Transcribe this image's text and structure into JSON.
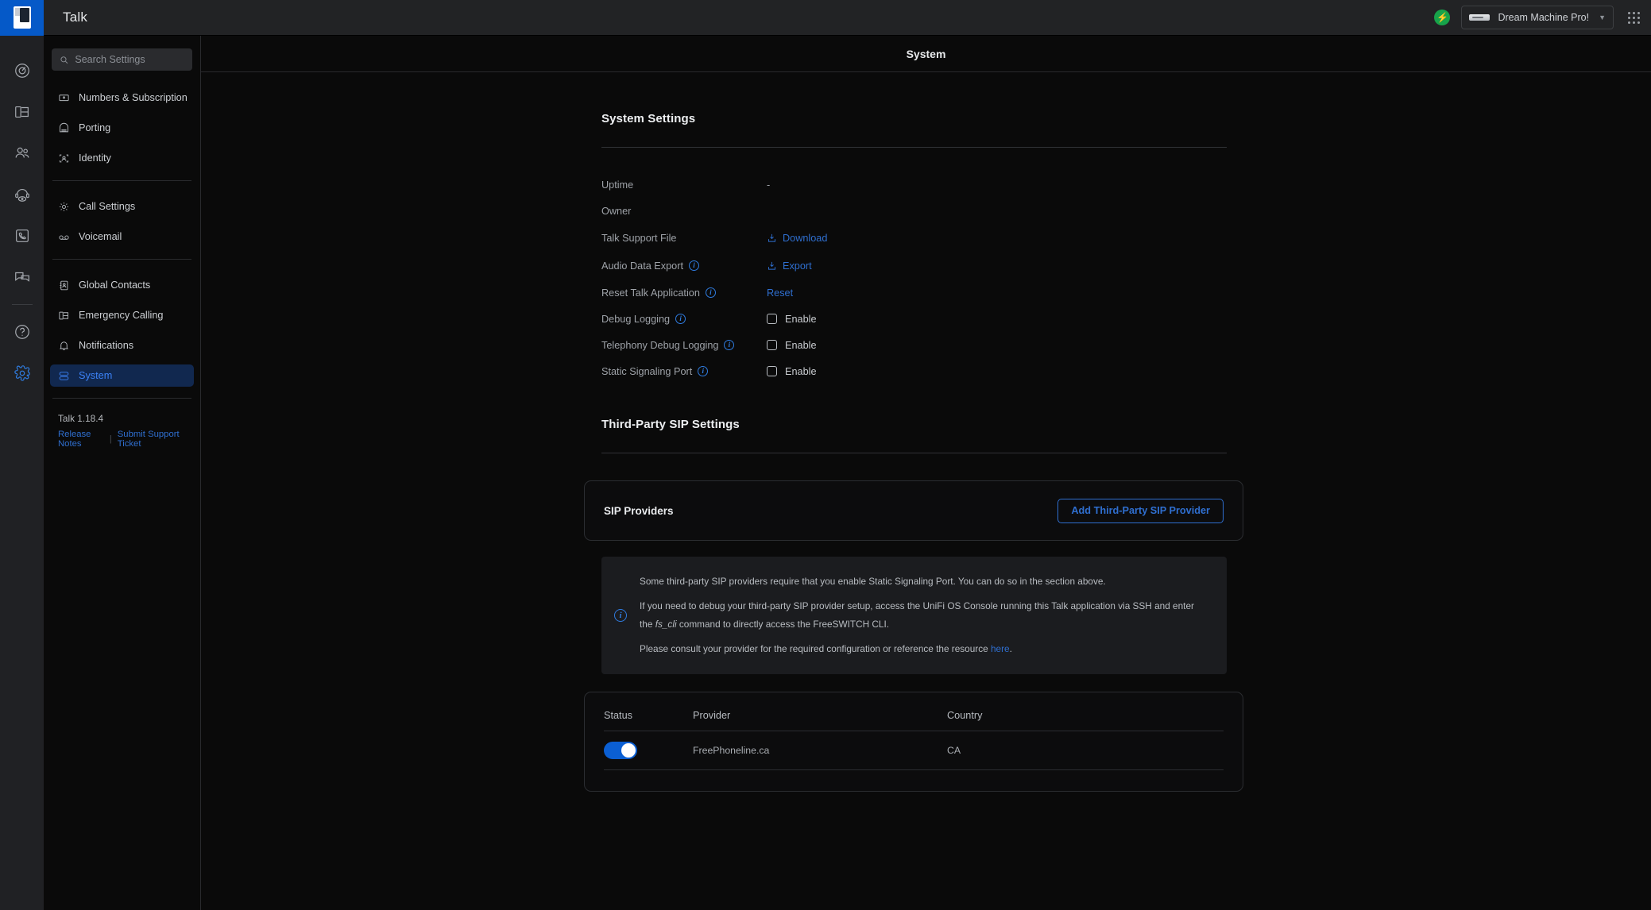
{
  "topbar": {
    "app_logo_icon": "talk-app-logo",
    "app_title": "Talk",
    "bolt_icon": "lightning-bolt-icon",
    "device_name": "Dream Machine Pro!",
    "device_icon": "device-icon",
    "chevron_icon": "chevron-down-icon",
    "launcher_icon": "app-grid-icon"
  },
  "rail": {
    "items": [
      {
        "icon": "dashboard-icon",
        "active": false
      },
      {
        "icon": "devices-icon",
        "active": false
      },
      {
        "icon": "users-icon",
        "active": false
      },
      {
        "icon": "agent-headset-icon",
        "active": false
      },
      {
        "icon": "contact-card-icon",
        "active": false
      },
      {
        "icon": "chat-bubbles-icon",
        "active": false
      },
      {
        "icon": "help-circle-icon",
        "active": false
      },
      {
        "icon": "settings-gear-icon",
        "active": true
      }
    ]
  },
  "sidebar": {
    "search": {
      "value": "",
      "placeholder": "Search Settings",
      "icon": "search-icon"
    },
    "groups": [
      {
        "items": [
          {
            "label": "Numbers & Subscription",
            "icon": "number-plate-icon",
            "active": false
          },
          {
            "label": "Porting",
            "icon": "porting-icon",
            "active": false
          },
          {
            "label": "Identity",
            "icon": "identity-icon",
            "active": false
          }
        ]
      },
      {
        "items": [
          {
            "label": "Call Settings",
            "icon": "gear-icon",
            "active": false
          },
          {
            "label": "Voicemail",
            "icon": "voicemail-icon",
            "active": false
          }
        ]
      },
      {
        "items": [
          {
            "label": "Global Contacts",
            "icon": "contacts-book-icon",
            "active": false
          },
          {
            "label": "Emergency Calling",
            "icon": "emergency-icon",
            "active": false
          },
          {
            "label": "Notifications",
            "icon": "bell-icon",
            "active": false
          },
          {
            "label": "System",
            "icon": "system-stack-icon",
            "active": true
          }
        ]
      }
    ],
    "version": "Talk 1.18.4",
    "release_notes_label": "Release Notes",
    "links_separator": "|",
    "support_ticket_label": "Submit Support Ticket"
  },
  "page": {
    "title": "System"
  },
  "system_settings": {
    "heading": "System Settings",
    "rows": [
      {
        "label": "Uptime",
        "info": false,
        "type": "text",
        "value": "-"
      },
      {
        "label": "Owner",
        "info": false,
        "type": "text",
        "value": ""
      },
      {
        "label": "Talk Support File",
        "info": false,
        "type": "link",
        "value": "Download",
        "icon": "download-icon"
      },
      {
        "label": "Audio Data Export",
        "info": true,
        "type": "link",
        "value": "Export",
        "icon": "download-icon"
      },
      {
        "label": "Reset Talk Application",
        "info": true,
        "type": "link",
        "value": "Reset",
        "icon": ""
      },
      {
        "label": "Debug Logging",
        "info": true,
        "type": "checkbox",
        "value": "Enable",
        "checked": false
      },
      {
        "label": "Telephony Debug Logging",
        "info": true,
        "type": "checkbox",
        "value": "Enable",
        "checked": false
      },
      {
        "label": "Static Signaling Port",
        "info": true,
        "type": "checkbox",
        "value": "Enable",
        "checked": false
      }
    ]
  },
  "sip_settings": {
    "heading": "Third-Party SIP Settings",
    "card_title": "SIP Providers",
    "add_button_label": "Add Third-Party SIP Provider",
    "banner": {
      "icon": "info-circle-icon",
      "line1": "Some third-party SIP providers require that you enable Static Signaling Port. You can do so in the section above.",
      "line2_a": "If you need to debug your third-party SIP provider setup, access the UniFi OS Console running this Talk application via SSH and enter the ",
      "line2_code": "fs_cli",
      "line2_b": " command to directly access the FreeSWITCH CLI.",
      "line3_a": "Please consult your provider for the required configuration or reference the resource ",
      "line3_link": "here",
      "line3_b": "."
    },
    "table": {
      "columns": [
        "Status",
        "Provider",
        "Country"
      ],
      "rows": [
        {
          "status_on": true,
          "provider": "FreePhoneline.ca",
          "country": "CA"
        }
      ]
    }
  },
  "colors": {
    "accent_blue": "#2f6fd0",
    "active_nav_bg": "#11284f",
    "toggle_on": "#0b5fd3",
    "brand_blue": "#0559c8",
    "status_green": "#17a34a"
  }
}
